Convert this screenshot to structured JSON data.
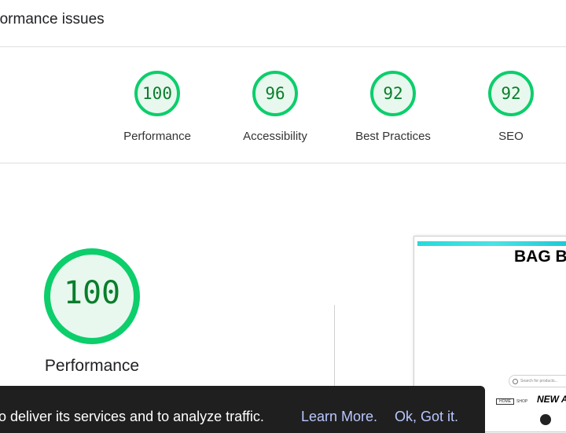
{
  "header": {
    "title": "rformance issues"
  },
  "categories": [
    {
      "score": "100",
      "label": "Performance",
      "value": 100
    },
    {
      "score": "96",
      "label": "Accessibility",
      "value": 96
    },
    {
      "score": "92",
      "label": "Best Practices",
      "value": 92
    },
    {
      "score": "92",
      "label": "SEO",
      "value": 92
    }
  ],
  "main": {
    "score": "100",
    "value": 100,
    "label": "Performance"
  },
  "preview": {
    "brand": "BAG B",
    "search_placeholder": "Search for products...",
    "nav_home": "HOME",
    "nav_shop": "SHOP",
    "new_arrivals": "NEW A"
  },
  "cookie": {
    "message": "o deliver its services and to analyze traffic.",
    "learn_more": "Learn More.",
    "accept": "Ok, Got it."
  },
  "colors": {
    "pass": "#0cce6b",
    "pass_fill": "#e8f8ee",
    "score_text": "#0a7d2c"
  }
}
